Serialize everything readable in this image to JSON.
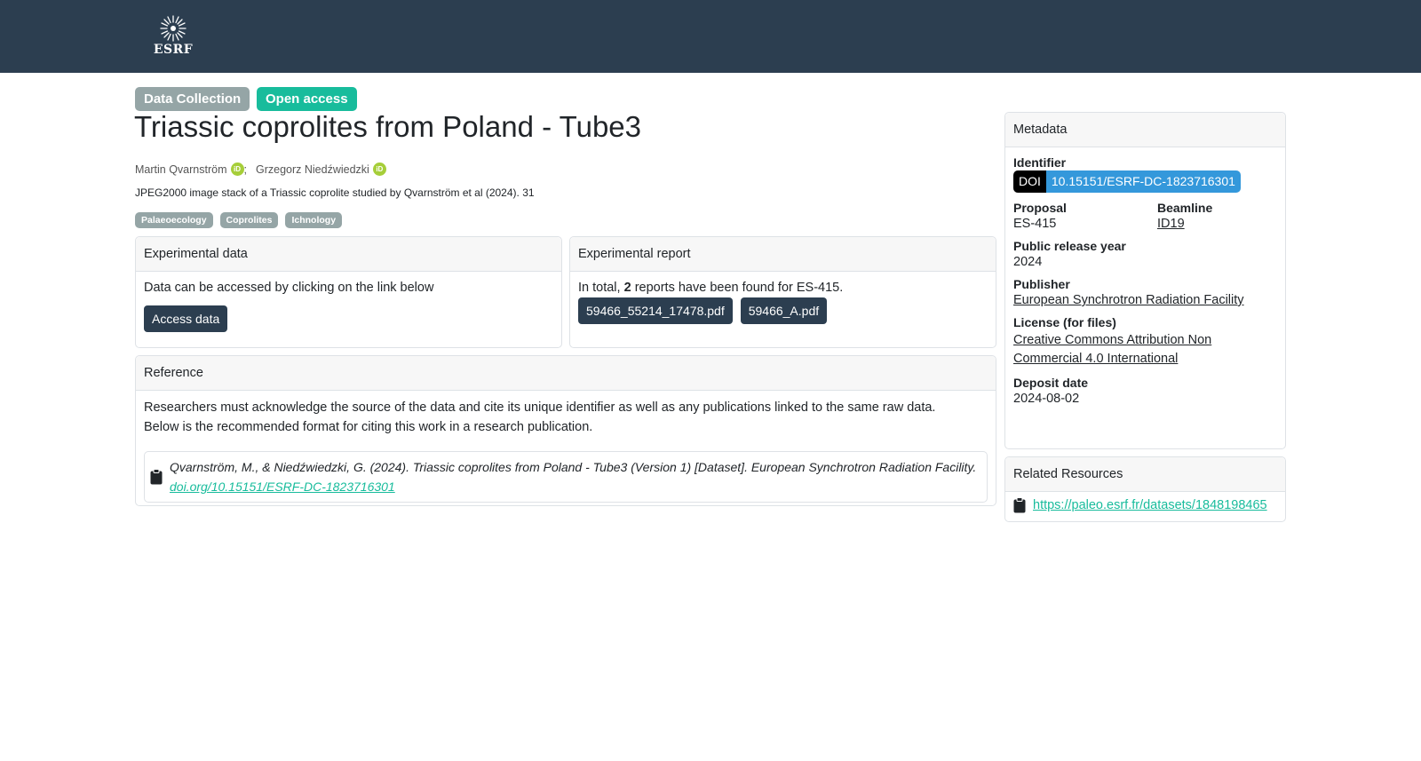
{
  "header": {
    "logo_text": "ESRF"
  },
  "badges": {
    "type": "Data Collection",
    "access": "Open access"
  },
  "title": "Triassic coprolites from Poland - Tube3",
  "authors": [
    {
      "name": "Martin Qvarnström"
    },
    {
      "name": "Grzegorz Niedźwiedzki"
    }
  ],
  "author_separator": ";",
  "orcid_label": "iD",
  "description": "JPEG2000 image stack of a Triassic coprolite studied by Qvarnström et al (2024). 31",
  "keywords": [
    "Palaeoecology",
    "Coprolites",
    "Ichnology"
  ],
  "experimental_data": {
    "header": "Experimental data",
    "text": "Data can be accessed by clicking on the link below",
    "button": "Access data"
  },
  "experimental_report": {
    "header": "Experimental report",
    "text_prefix": "In total, ",
    "count": "2",
    "text_suffix": " reports have been found for ES-415.",
    "files": [
      "59466_55214_17478.pdf",
      "59466_A.pdf"
    ]
  },
  "reference": {
    "header": "Reference",
    "line1": "Researchers must acknowledge the source of the data and cite its unique identifier as well as any publications linked to the same raw data.",
    "line2": "Below is the recommended format for citing this work in a research publication.",
    "citation": "Qvarnström, M., & Niedźwiedzki, G. (2024). Triassic coprolites from Poland - Tube3 (Version 1) [Dataset]. European Synchrotron Radiation Facility.",
    "citation_link": "doi.org/10.15151/ESRF-DC-1823716301"
  },
  "metadata": {
    "header": "Metadata",
    "identifier_label": "Identifier",
    "doi_label": "DOI",
    "doi_value": "10.15151/ESRF-DC-1823716301",
    "proposal_label": "Proposal",
    "proposal_value": "ES-415",
    "beamline_label": "Beamline",
    "beamline_value": "ID19",
    "release_label": "Public release year",
    "release_value": "2024",
    "publisher_label": "Publisher",
    "publisher_value": "European Synchrotron Radiation Facility",
    "license_label": "License (for files)",
    "license_line1": "Creative Commons Attribution Non",
    "license_line2": "Commercial 4.0 International",
    "deposit_label": "Deposit date",
    "deposit_value": "2024-08-02"
  },
  "related": {
    "header": "Related Resources",
    "link": "https://paleo.esrf.fr/datasets/1848198465"
  },
  "colors": {
    "navbar": "#2c3e50",
    "accent_green": "#18bc9c",
    "badge_gray": "#95a5a6",
    "doi_blue": "#3498db",
    "orcid_green": "#a6ce39"
  }
}
